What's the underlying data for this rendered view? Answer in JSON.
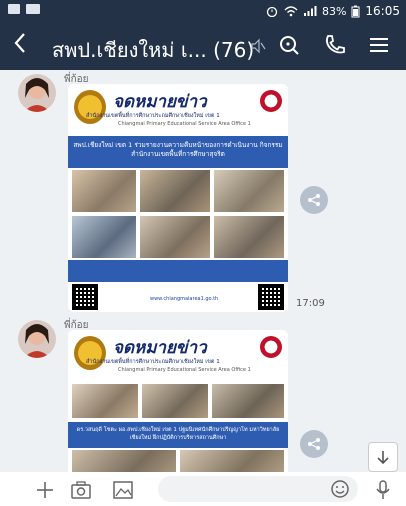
{
  "status_bar": {
    "battery": "83%",
    "time": "16:05"
  },
  "header": {
    "title": "สพป.เชียงใหม่ เ...",
    "member_count": "(76)"
  },
  "messages": [
    {
      "sender": "พี่ก้อย",
      "time": "17:09",
      "card": {
        "title": "จดหมายข่าว",
        "subtitle": "สำนักงานเขตพื้นที่การศึกษาประถมศึกษาเชียงใหม่ เขต 1",
        "subtitle_en": "Chiangmai Primary Educational Service Area Office 1",
        "banner": "สพป.เชียงใหม่ เขต 1 ร่วมรายงานความคืบหน้าของการดำเนินงาน กิจกรรมสำนักงานเขตพื้นที่การศึกษาสุจริต",
        "website": "www.chiangmaiarea1.go.th"
      }
    },
    {
      "sender": "พี่ก้อย",
      "card": {
        "title": "จดหมายข่าว",
        "subtitle": "สำนักงานเขตพื้นที่การศึกษาประถมศึกษาเชียงใหม่ เขต 1",
        "subtitle_en": "Chiangmai Primary Educational Service Area Office 1",
        "banner": "ดร.วสนฤดี โชตะ ผอ.สพป.เชียงใหม่ เขต 1 ปฐมนิเทศนักศึกษาปริญญาโท มหาวิทยาลัยเชียงใหม่ ฝึกปฏิบัติการบริหารสถานศึกษา"
      }
    }
  ],
  "input": {
    "placeholder": ""
  }
}
